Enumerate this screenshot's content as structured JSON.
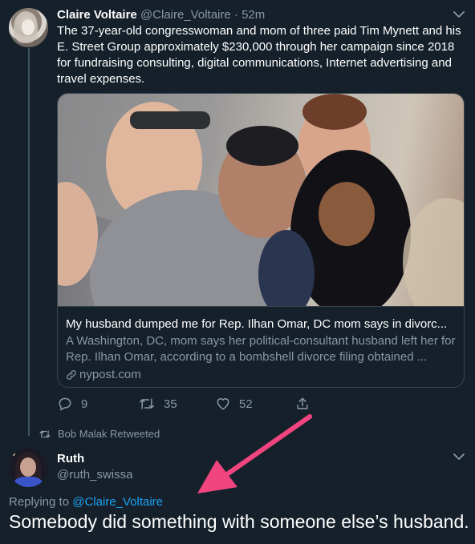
{
  "tweet": {
    "name": "Claire Voltaire",
    "handle": "@Claire_Voltaire",
    "separator": "·",
    "time": "52m",
    "text": "The 37-year-old congresswoman and mom of three paid Tim Mynett and his E. Street Group approximately $230,000 through her campaign since 2018 for fundraising consulting, digital communications, Internet advertising and travel expenses.",
    "card": {
      "title": "My husband dumped me for Rep. Ilhan Omar, DC mom says in divorc...",
      "description": "A Washington, DC, mom says her political-consultant husband left her for Rep. Ilhan Omar, according to a bombshell divorce filing obtained ...",
      "domain": "nypost.com",
      "link_icon": "link-icon"
    },
    "actions": {
      "reply_count": "9",
      "retweet_count": "35",
      "like_count": "52"
    }
  },
  "retweet_banner": {
    "text": "Bob Malak Retweeted",
    "icon": "retweet-icon"
  },
  "reply": {
    "name": "Ruth",
    "handle": "@ruth_swissa",
    "replying_prefix": "Replying to",
    "replying_to": "@Claire_Voltaire",
    "text": "Somebody did something with someone else’s husband."
  },
  "colors": {
    "background": "#15202b",
    "muted": "#8899a6",
    "link": "#1da1f2",
    "border": "#38444d",
    "annotation_arrow": "#f0457f"
  }
}
